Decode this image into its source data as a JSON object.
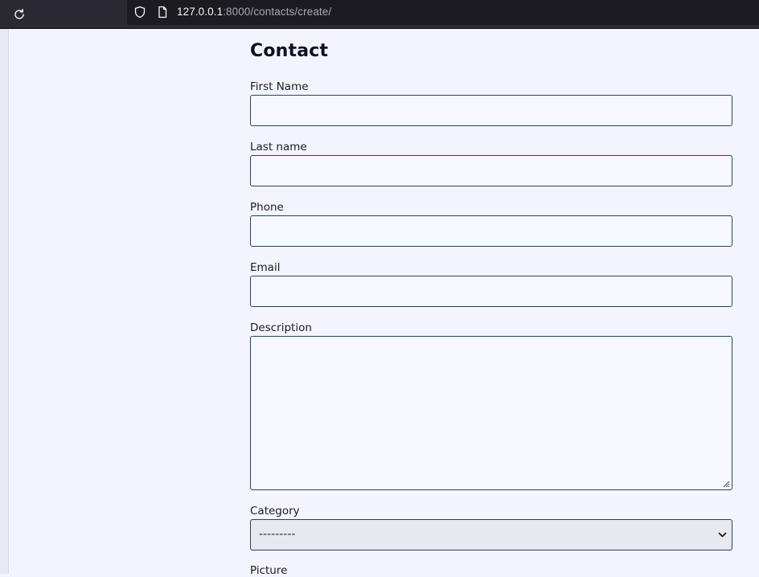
{
  "browser": {
    "url_host": "127.0.0.1",
    "url_rest": ":8000/contacts/create/"
  },
  "form": {
    "title": "Contact",
    "first_name": {
      "label": "First Name",
      "value": ""
    },
    "last_name": {
      "label": "Last name",
      "value": ""
    },
    "phone": {
      "label": "Phone",
      "value": ""
    },
    "email": {
      "label": "Email",
      "value": ""
    },
    "description": {
      "label": "Description",
      "value": ""
    },
    "category": {
      "label": "Category",
      "selected": "---------"
    },
    "picture": {
      "label": "Picture"
    }
  },
  "icons": {
    "reload": "reload-icon",
    "shield": "shield-icon",
    "page": "page-icon",
    "chevron": "chevron-down-icon"
  }
}
